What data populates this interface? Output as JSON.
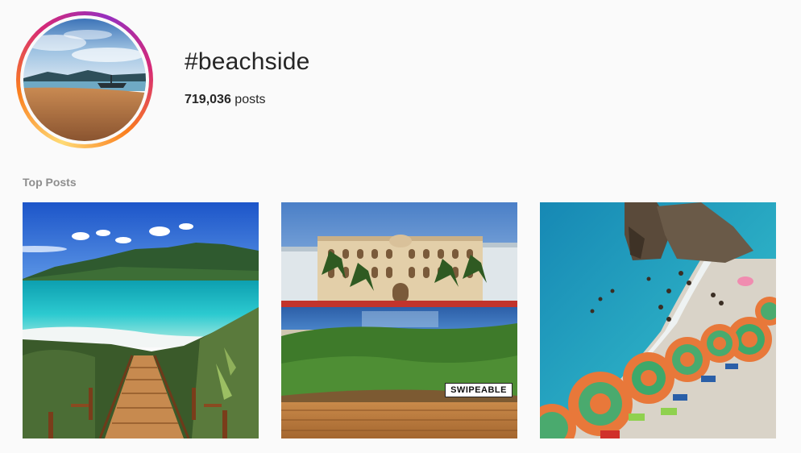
{
  "header": {
    "hashtag": "#beachside",
    "post_count": "719,036",
    "post_count_suffix": " posts"
  },
  "sections": {
    "top_posts_label": "Top Posts"
  },
  "posts": [
    {
      "badge": ""
    },
    {
      "badge": "SWIPEABLE"
    },
    {
      "badge": ""
    }
  ],
  "colors": {
    "ring_gradient": [
      "#feda75",
      "#fa7e1e",
      "#d62976",
      "#962fbf"
    ],
    "muted_text": "#8e8e8e",
    "text": "#262626",
    "background": "#fafafa"
  }
}
